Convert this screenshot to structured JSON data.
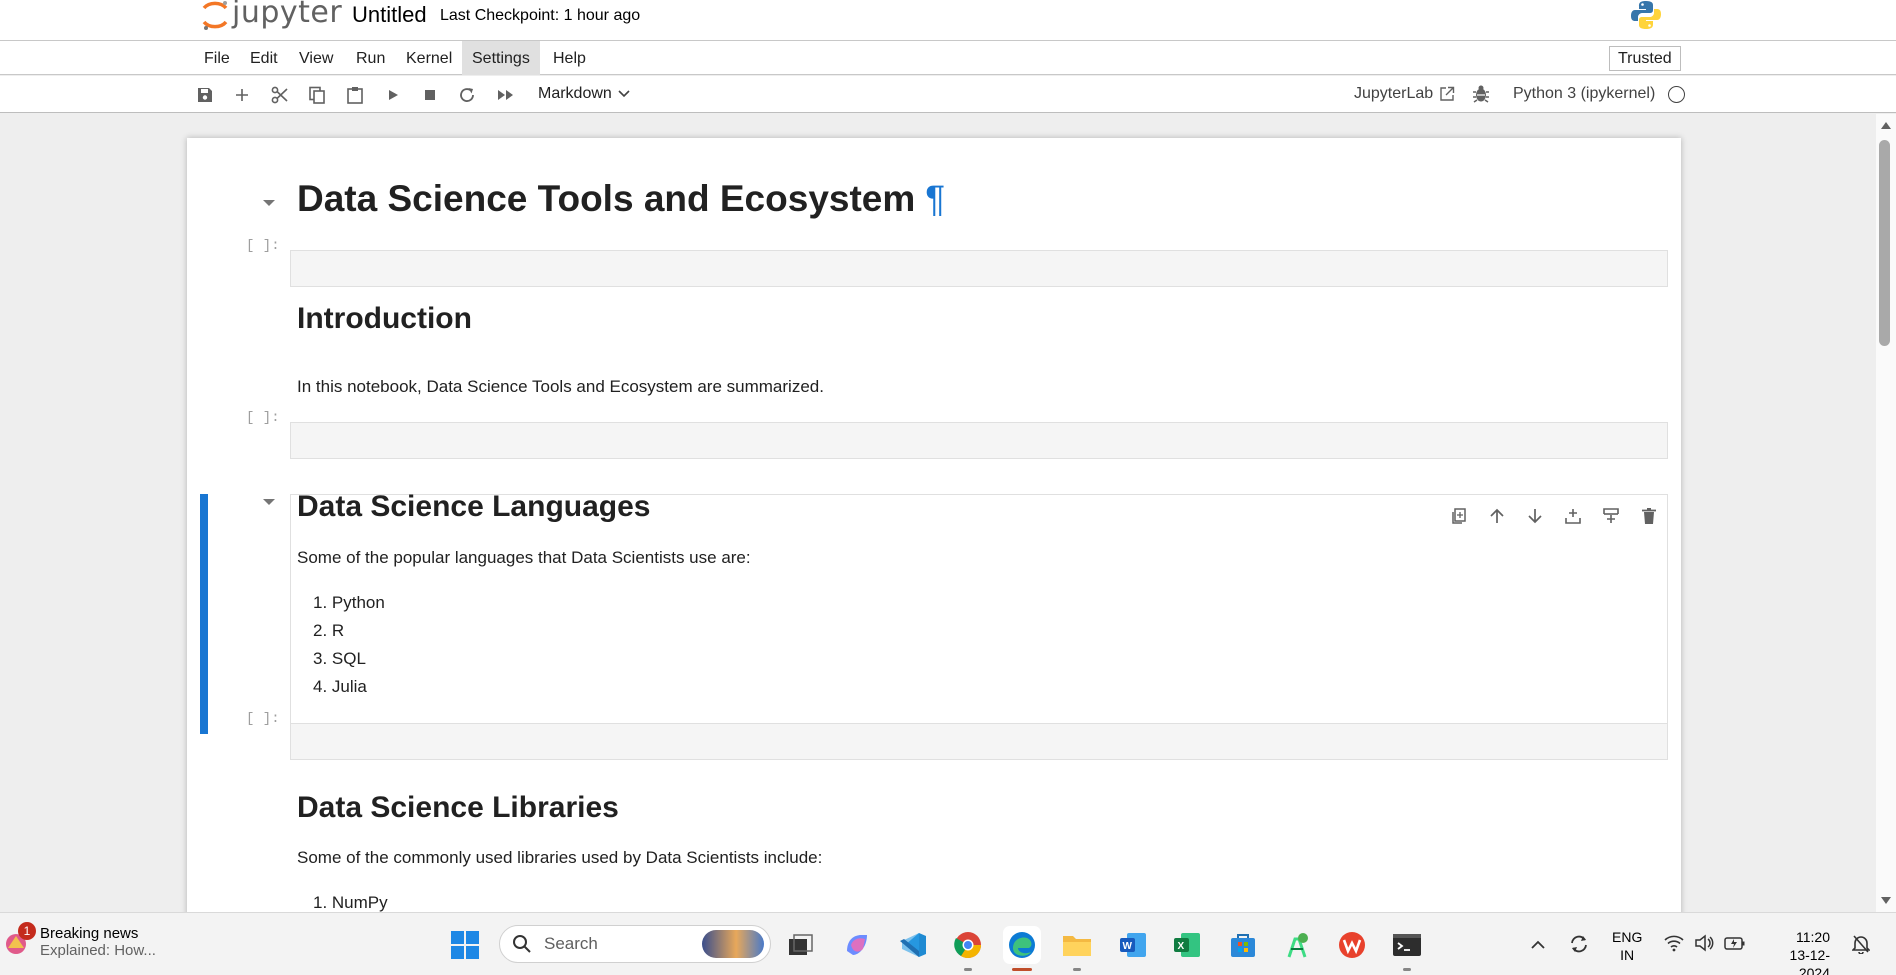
{
  "header": {
    "logo_text": "jupyter",
    "notebook_title": "Untitled",
    "checkpoint": "Last Checkpoint: 1 hour ago"
  },
  "menu": {
    "items": [
      "File",
      "Edit",
      "View",
      "Run",
      "Kernel",
      "Settings",
      "Help"
    ],
    "active": "Settings",
    "trusted": "Trusted"
  },
  "toolbar": {
    "buttons": [
      "save-icon",
      "add-cell-icon",
      "cut-icon",
      "copy-icon",
      "paste-icon",
      "run-icon",
      "stop-icon",
      "restart-icon",
      "fast-forward-icon"
    ],
    "cell_type": "Markdown",
    "jupyterlab_link": "JupyterLab",
    "kernel_name": "Python 3 (ipykernel)"
  },
  "cells": {
    "title_heading": "Data Science Tools and Ecosystem",
    "anchor_symbol": "¶",
    "empty_prompt": "[ ]:",
    "intro_heading": "Introduction",
    "intro_text": "In this notebook, Data Science Tools and Ecosystem are summarized.",
    "languages_heading": "Data Science Languages",
    "languages_text": "Some of the popular languages that Data Scientists use are:",
    "languages": [
      "Python",
      "R",
      "SQL",
      "Julia"
    ],
    "libraries_heading": "Data Science Libraries",
    "libraries_text": "Some of the commonly used libraries used by Data Scientists include:",
    "libraries": [
      "NumPy"
    ]
  },
  "cell_toolbar": [
    "duplicate-icon",
    "move-up-icon",
    "move-down-icon",
    "insert-below-icon",
    "insert-above-icon",
    "delete-icon"
  ],
  "taskbar": {
    "news_badge": "1",
    "news_title": "Breaking news",
    "news_subtitle": "Explained: How...",
    "search_placeholder": "Search",
    "apps": [
      "task-view",
      "copilot",
      "vscode",
      "chrome",
      "edge",
      "file-explorer",
      "word",
      "excel",
      "store",
      "android-studio",
      "wps",
      "terminal"
    ],
    "language_line1": "ENG",
    "language_line2": "IN",
    "time": "11:20",
    "date": "13-12-2024"
  },
  "colors": {
    "accent": "#1976d2",
    "jupyter_orange": "#f37726",
    "active_taskbar": "#c04e2b"
  }
}
